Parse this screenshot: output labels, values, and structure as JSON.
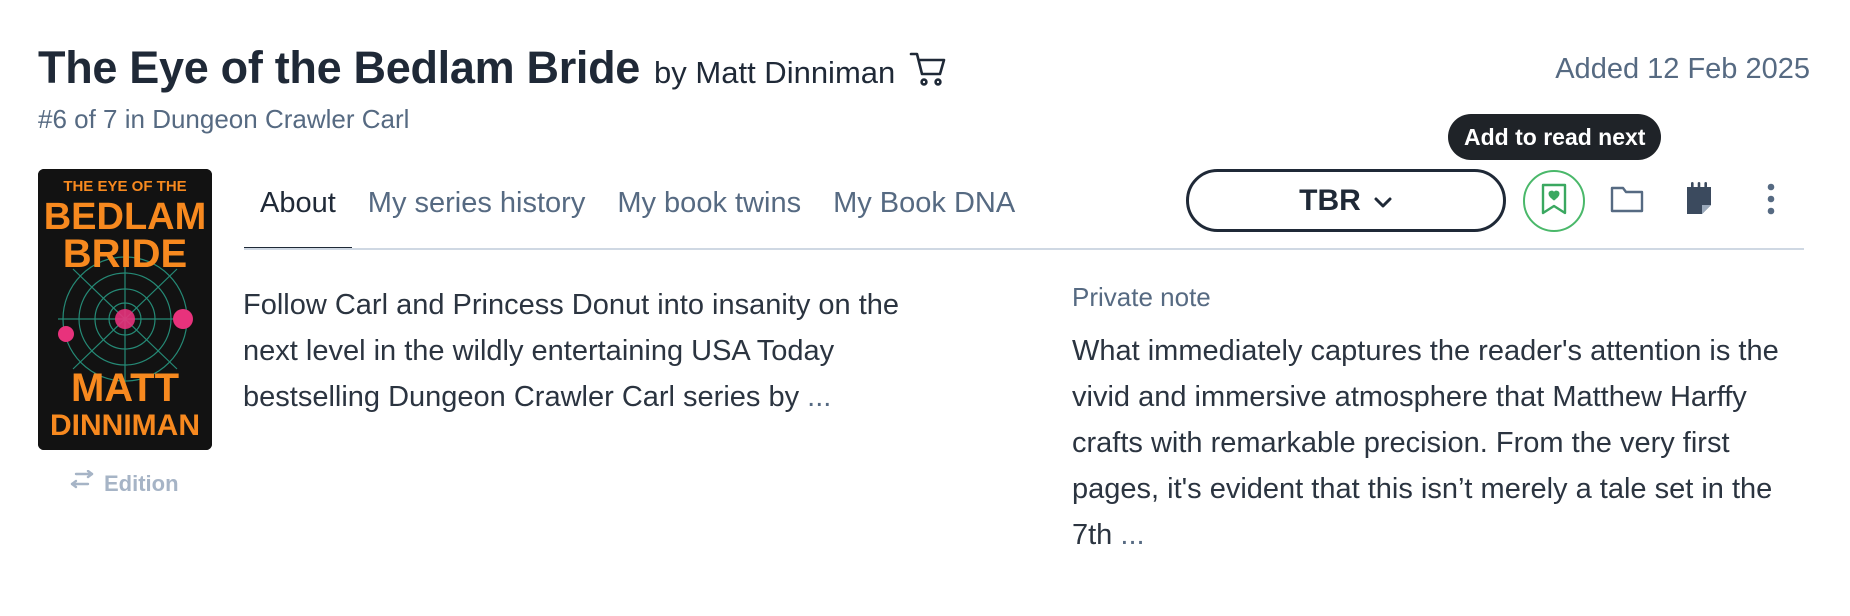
{
  "book": {
    "title": "The Eye of the Bedlam Bride",
    "by_author": "by Matt Dinniman",
    "series": "#6 of 7 in Dungeon Crawler Carl",
    "added": "Added 12 Feb 2025",
    "cover_title_lines": [
      "THE EYE OF THE",
      "BEDLAM",
      "BRIDE"
    ],
    "cover_author_lines": [
      "MATT",
      "DINNIMAN"
    ]
  },
  "edition": {
    "label": "Edition",
    "icon": "swap-icon"
  },
  "tabs": [
    {
      "label": "About",
      "active": true
    },
    {
      "label": "My series history",
      "active": false
    },
    {
      "label": "My book twins",
      "active": false
    },
    {
      "label": "My Book DNA",
      "active": false
    }
  ],
  "status": {
    "label": "TBR",
    "icon": "chevron-down-icon"
  },
  "tooltip": {
    "text": "Add to read next"
  },
  "actions": [
    {
      "name": "add-to-read-next-button",
      "icon": "bookmark-heart-icon"
    },
    {
      "name": "folder-button",
      "icon": "folder-icon"
    },
    {
      "name": "notes-button",
      "icon": "note-icon"
    },
    {
      "name": "more-options-button",
      "icon": "more-vertical-icon"
    }
  ],
  "about": {
    "description": "Follow Carl and Princess Donut into insanity on the next level in the wildly entertaining USA Today bestselling Dungeon Crawler Carl series by",
    "more": "..."
  },
  "private_note": {
    "label": "Private note",
    "text": "What immediately captures the reader's attention is the vivid and immersive atmosphere that Matthew Harffy crafts with remarkable precision. From the very first pages, it's evident that this isn’t merely a tale set in the 7th",
    "more": "..."
  },
  "colors": {
    "text_dark": "#1f2937",
    "text_muted": "#566a82",
    "accent_green": "#4ab86a",
    "cover_orange": "#f7891f",
    "tooltip_bg": "#1f2328"
  }
}
